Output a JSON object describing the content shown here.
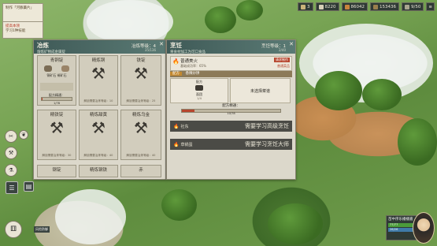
{
  "topbar": {
    "day": "3",
    "silver": "8220",
    "copper": "86042",
    "reputation": "153436",
    "count": "9/50"
  },
  "quests": [
    {
      "title": "",
      "text": "制作「河豚藥片」"
    },
    {
      "title": "提高本领",
      "text": "学习1种技能"
    }
  ],
  "forge": {
    "title": "冶炼",
    "subtitle": "熔炼矿物成金属锭",
    "level_label": "冶炼等级：",
    "level": "4",
    "level_progress": "35/136",
    "cards": [
      {
        "name": "青铜锭",
        "mats": "铜矿石  锡矿石",
        "req": "",
        "bar": "配方精通：",
        "progress": "1/78",
        "fill": 0.02
      },
      {
        "name": "精炼铜",
        "req": "解锁需要冶炼等级：10"
      },
      {
        "name": "铁锭",
        "req": "解锁需要冶炼等级：25"
      },
      {
        "name": "精铁锭",
        "req": "解锁需要冶炼等级：30"
      },
      {
        "name": "精炼甜黄",
        "req": "解锁需要冶炼等级：40"
      },
      {
        "name": "精炼乌金",
        "req": "解锁需要冶炼等级：40"
      },
      {
        "name": "钢锭"
      },
      {
        "name": "精炼钢铁"
      },
      {
        "name": "赤"
      }
    ]
  },
  "cook": {
    "title": "烹饪",
    "subtitle": "将食材加工为可口食品",
    "level_label": "烹饪等级：",
    "level": "1",
    "level_progress": "2/40",
    "dish": "普通美火",
    "dish_rate": "基础成功率：65%",
    "tag": "请求制作",
    "tag2": "普通菜品",
    "section": "配方",
    "section_name": "香辣炒饼",
    "recipe_label": "配方",
    "ingredient": "面团",
    "ingredient_count": "1/4",
    "empty_slot": "未选择菜谱",
    "mastery_label": "配方精通：",
    "mastery": "10/78",
    "mastery_fill": 0.13,
    "rows": [
      {
        "name": "社东",
        "lock": "需要学习高级烹饪"
      },
      {
        "name": "草锅蛋",
        "lock": "需要学习烹饪大师"
      }
    ]
  },
  "character": {
    "name": "苗中序乐播播嘉",
    "hp": "77/77",
    "mp": "26/26"
  },
  "sidebar": {
    "btn1": "✂",
    "btn2": "❦",
    "btn3": "⚒",
    "btn4": "⚗",
    "btn5": "☰",
    "btn6": "▤"
  },
  "bottom_left": {
    "label": "风险防御"
  }
}
